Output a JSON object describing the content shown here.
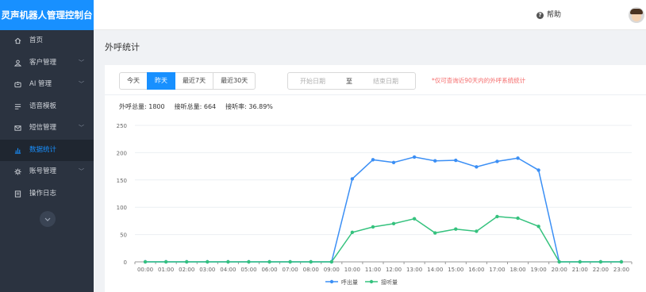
{
  "app": {
    "title": "灵声机器人管理控制台",
    "help_label": "帮助",
    "help_icon": "?",
    "brand_color": "#1890ff"
  },
  "sidebar": {
    "items": [
      {
        "label": "首页",
        "icon": "home-icon",
        "expandable": false,
        "active": false
      },
      {
        "label": "客户管理",
        "icon": "user-icon",
        "expandable": true,
        "active": false
      },
      {
        "label": "AI 管理",
        "icon": "robot-icon",
        "expandable": true,
        "active": false
      },
      {
        "label": "语音模板",
        "icon": "template-icon",
        "expandable": false,
        "active": false
      },
      {
        "label": "短信管理",
        "icon": "mail-icon",
        "expandable": true,
        "active": false
      },
      {
        "label": "数据统计",
        "icon": "bar-chart-icon",
        "expandable": false,
        "active": true
      },
      {
        "label": "账号管理",
        "icon": "gear-icon",
        "expandable": true,
        "active": false
      },
      {
        "label": "操作日志",
        "icon": "log-icon",
        "expandable": false,
        "active": false
      }
    ],
    "chevron": "﹀",
    "collapse_icon": "chevron-down-circle-icon"
  },
  "page": {
    "title": "外呼统计"
  },
  "filter": {
    "buttons": [
      "今天",
      "昨天",
      "最近7天",
      "最近30天"
    ],
    "active_index": 1,
    "start_placeholder": "开始日期",
    "separator": "至",
    "end_placeholder": "结束日期",
    "hint": "*仅可查询近90天内的外呼系统统计"
  },
  "stats": {
    "total_label": "外呼总量:",
    "total_value": "1800",
    "answered_label": "接听总量:",
    "answered_value": "664",
    "rate_label": "接听率:",
    "rate_value": "36.89%"
  },
  "chart_data": {
    "type": "line",
    "categories": [
      "00:00",
      "01:00",
      "02:00",
      "03:00",
      "04:00",
      "05:00",
      "06:00",
      "07:00",
      "08:00",
      "09:00",
      "10:00",
      "11:00",
      "12:00",
      "13:00",
      "14:00",
      "15:00",
      "16:00",
      "17:00",
      "18:00",
      "19:00",
      "20:00",
      "21:00",
      "22:00",
      "23:00"
    ],
    "series": [
      {
        "name": "呼出量",
        "color": "#3b8ff5",
        "values": [
          0,
          0,
          0,
          0,
          0,
          0,
          0,
          0,
          0,
          0,
          152,
          187,
          182,
          192,
          185,
          186,
          174,
          184,
          190,
          168,
          0,
          0,
          0,
          0
        ]
      },
      {
        "name": "接听量",
        "color": "#35c27e",
        "values": [
          0,
          0,
          0,
          0,
          0,
          0,
          0,
          0,
          0,
          0,
          54,
          64,
          70,
          79,
          53,
          60,
          56,
          83,
          80,
          65,
          0,
          0,
          0,
          0
        ]
      }
    ],
    "yticks": [
      0,
      50,
      100,
      150,
      200,
      250
    ],
    "ylim": [
      0,
      250
    ],
    "grid": true,
    "legend": "bottom-center"
  }
}
